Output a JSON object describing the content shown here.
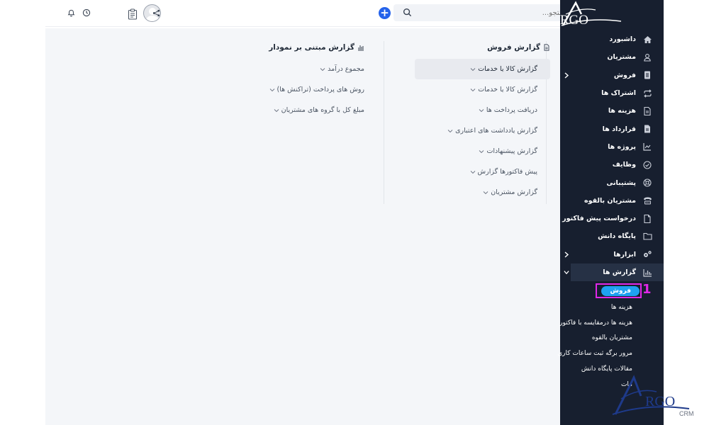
{
  "topbar": {
    "search_placeholder": "جستجو...",
    "icons": [
      "bell-icon",
      "clock-icon",
      "avatar",
      "clipboard-icon",
      "share-icon",
      "plus-icon",
      "search-icon",
      "menu-icon"
    ]
  },
  "sales_report": {
    "title": "گزارش فروش",
    "items": [
      {
        "label": "گزارش کالا یا خدمات",
        "active": true
      },
      {
        "label": "گزارش کالا یا خدمات",
        "active": false
      },
      {
        "label": "دریافت پرداخت ها",
        "active": false
      },
      {
        "label": "گزارش یادداشت های اعتباری",
        "active": false
      },
      {
        "label": "گزارش پیشنهادات",
        "active": false
      },
      {
        "label": "پیش فاکتورها گزارش",
        "active": false
      },
      {
        "label": "گزارش مشتریان",
        "active": false
      }
    ]
  },
  "chart_report": {
    "title": "گزارش مبتنی بر نمودار",
    "items": [
      {
        "label": "مجموع درآمد"
      },
      {
        "label": "روش های پرداخت (تراکنش ها)"
      },
      {
        "label": "مبلغ کل با گروه های مشتریان"
      }
    ]
  },
  "sidebar": {
    "logo_text": "RGO",
    "items": [
      {
        "label": "داشبورد",
        "icon": "home-icon"
      },
      {
        "label": "مشتریان",
        "icon": "user-icon"
      },
      {
        "label": "فروش",
        "icon": "receipt-icon",
        "has_children": true
      },
      {
        "label": "اشتراک ها",
        "icon": "repeat-icon"
      },
      {
        "label": "هزینه ها",
        "icon": "file-icon"
      },
      {
        "label": "قرارداد ها",
        "icon": "contract-icon"
      },
      {
        "label": "پروژه ها",
        "icon": "chart-icon"
      },
      {
        "label": "وظایف",
        "icon": "check-circle-icon"
      },
      {
        "label": "پشتیبانی",
        "icon": "support-icon"
      },
      {
        "label": "مشتریان بالقوه",
        "icon": "tty-icon"
      },
      {
        "label": "درخواست پیش فاکتور",
        "icon": "document-icon"
      },
      {
        "label": "پایگاه دانش",
        "icon": "folder-icon"
      },
      {
        "label": "ابزارها",
        "icon": "cogs-icon",
        "has_children": true
      },
      {
        "label": "گزارش ها",
        "icon": "bar-chart-icon",
        "open": true
      }
    ],
    "sub_items": [
      {
        "label": "فروش",
        "active": true
      },
      {
        "label": "هزینه ها"
      },
      {
        "label": "هزینه ها درمقایسه با فاکتور"
      },
      {
        "label": "مشتریان بالقوه"
      },
      {
        "label": "مرور برگه ثبت ساعات کاری"
      },
      {
        "label": "مقالات پایگاه دانش"
      },
      {
        "label": "مات"
      }
    ]
  },
  "annotation": {
    "number": "1",
    "color": "#e027e8"
  },
  "watermark": {
    "text": "RGO",
    "sub": "CRM"
  },
  "colors": {
    "sidebar_bg": "#171f2f",
    "accent": "#1ea1f2",
    "primary": "#2563eb",
    "content_bg": "#f4f6f9"
  }
}
